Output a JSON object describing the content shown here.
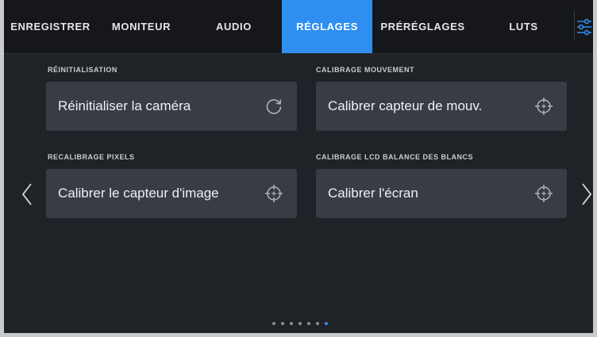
{
  "tabs": [
    {
      "label": "ENREGISTRER",
      "active": false
    },
    {
      "label": "MONITEUR",
      "active": false
    },
    {
      "label": "AUDIO",
      "active": false
    },
    {
      "label": "RÉGLAGES",
      "active": true
    },
    {
      "label": "PRÉRÉGLAGES",
      "active": false
    },
    {
      "label": "LUTS",
      "active": false
    }
  ],
  "sections": [
    {
      "label": "RÉINITIALISATION",
      "button": "Réinitialiser la caméra",
      "icon": "refresh-icon"
    },
    {
      "label": "CALIBRAGE MOUVEMENT",
      "button": "Calibrer capteur de mouv.",
      "icon": "crosshair-icon"
    },
    {
      "label": "RECALIBRAGE PIXELS",
      "button": "Calibrer le capteur d'image",
      "icon": "crosshair-icon"
    },
    {
      "label": "CALIBRAGE LCD BALANCE DES BLANCS",
      "button": "Calibrer l'écran",
      "icon": "crosshair-icon"
    }
  ],
  "pagination": {
    "total": 7,
    "current": 7
  },
  "colors": {
    "accent": "#2e8ff0",
    "background": "#1f2227",
    "card": "#383d45"
  }
}
